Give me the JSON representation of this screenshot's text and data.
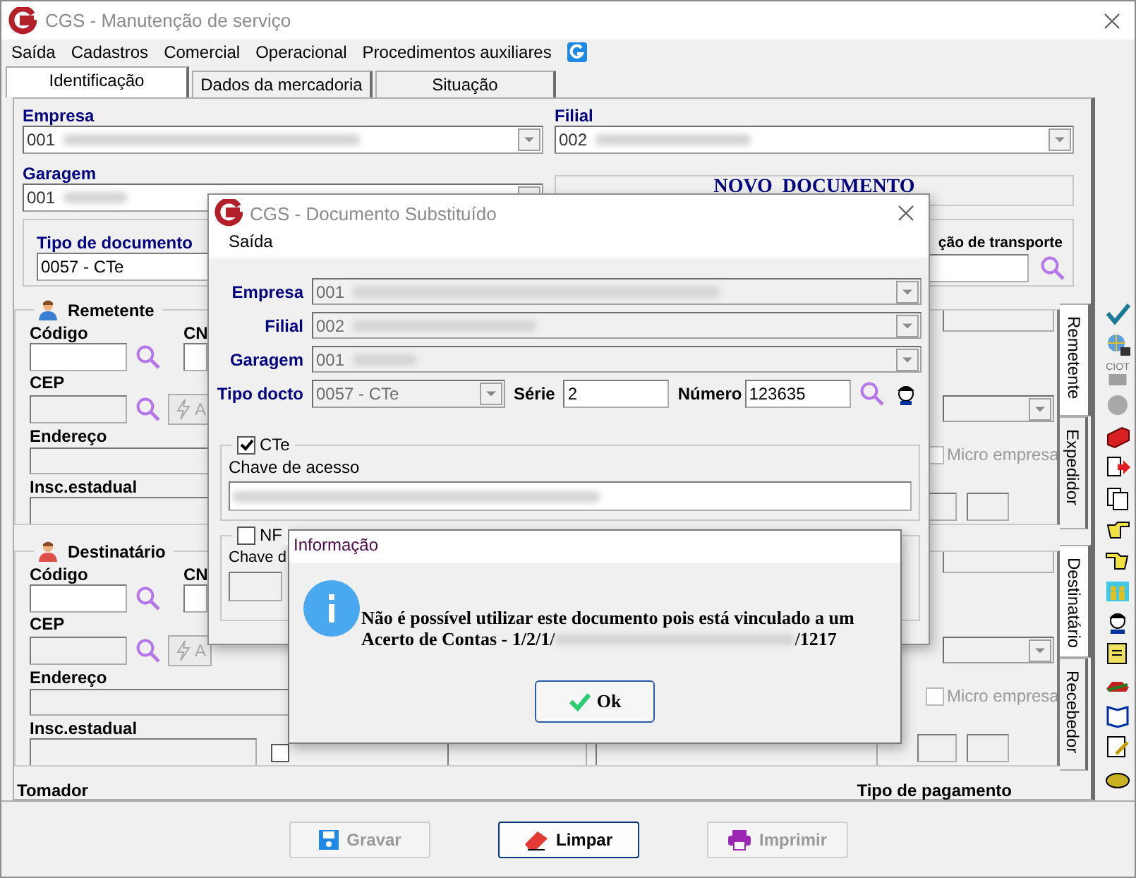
{
  "window": {
    "title": "CGS - Manutenção de serviço"
  },
  "menu": [
    "Saída",
    "Cadastros",
    "Comercial",
    "Operacional",
    "Procedimentos auxiliares"
  ],
  "tabs": [
    {
      "label": "Identificação",
      "selected": true
    },
    {
      "label": "Dados da mercadoria",
      "selected": false
    },
    {
      "label": "Situação",
      "selected": false
    }
  ],
  "empresa": {
    "label": "Empresa",
    "value": "001"
  },
  "filial": {
    "label": "Filial",
    "value": "002"
  },
  "garagem": {
    "label": "Garagem",
    "value": "001"
  },
  "status_banner": "NOVO  DOCUMENTO",
  "tipo_documento": {
    "label": "Tipo de documento",
    "value": "0057 - CTe"
  },
  "transport_label": "ção de transporte",
  "parties": [
    {
      "title": "Remetente",
      "color": "#3a7fd5",
      "codigo_label": "Código",
      "cnpj_label": "CN",
      "cep_label": "CEP",
      "button_label": "A",
      "endereco_label": "Endereço",
      "insc_label": "Insc.estadual",
      "micro_empresa": "Micro empresa",
      "micro_checked": false,
      "side_tabs": [
        {
          "label": "Remetente",
          "selected": true
        },
        {
          "label": "Expedidor",
          "selected": false
        }
      ]
    },
    {
      "title": "Destinatário",
      "color": "#e0504a",
      "codigo_label": "Código",
      "cnpj_label": "CN",
      "cep_label": "CEP",
      "button_label": "A",
      "endereco_label": "Endereço",
      "insc_label": "Insc.estadual",
      "micro_empresa": "Micro empresa",
      "micro_checked": false,
      "option_checked": false,
      "side_tabs": [
        {
          "label": "Destinatário",
          "selected": true
        },
        {
          "label": "Recebedor",
          "selected": false
        }
      ]
    }
  ],
  "toolbar_ciot": "CIOT",
  "footer": {
    "tomador": "Tomador",
    "tipo_pagamento": "Tipo de pagamento"
  },
  "buttons": [
    {
      "label": "Gravar",
      "kind": "save",
      "disabled": true,
      "focused": false
    },
    {
      "label": "Limpar",
      "kind": "clear",
      "disabled": false,
      "focused": true
    },
    {
      "label": "Imprimir",
      "kind": "print",
      "disabled": true,
      "focused": false
    }
  ],
  "dialog": {
    "title": "CGS - Documento Substituído",
    "menu": "Saída",
    "rows": [
      {
        "label": "Empresa",
        "value": "001"
      },
      {
        "label": "Filial",
        "value": "002"
      },
      {
        "label": "Garagem",
        "value": "001"
      }
    ],
    "tipo_docto": {
      "label": "Tipo docto",
      "value": "0057 - CTe"
    },
    "serie": {
      "label": "Série",
      "value": "2"
    },
    "numero": {
      "label": "Número",
      "value": "123635"
    },
    "cte": {
      "label": "CTe",
      "checked": true,
      "key_label": "Chave de acesso"
    },
    "nfe": {
      "label": "NF",
      "checked": false,
      "key_label": "Chave d"
    }
  },
  "info": {
    "title": "Informação",
    "line1": "Não é possível utilizar este documento pois está vinculado a um",
    "line2_start": "Acerto de Contas - 1/2/1/",
    "line2_end": "/1217",
    "ok": "Ok"
  }
}
